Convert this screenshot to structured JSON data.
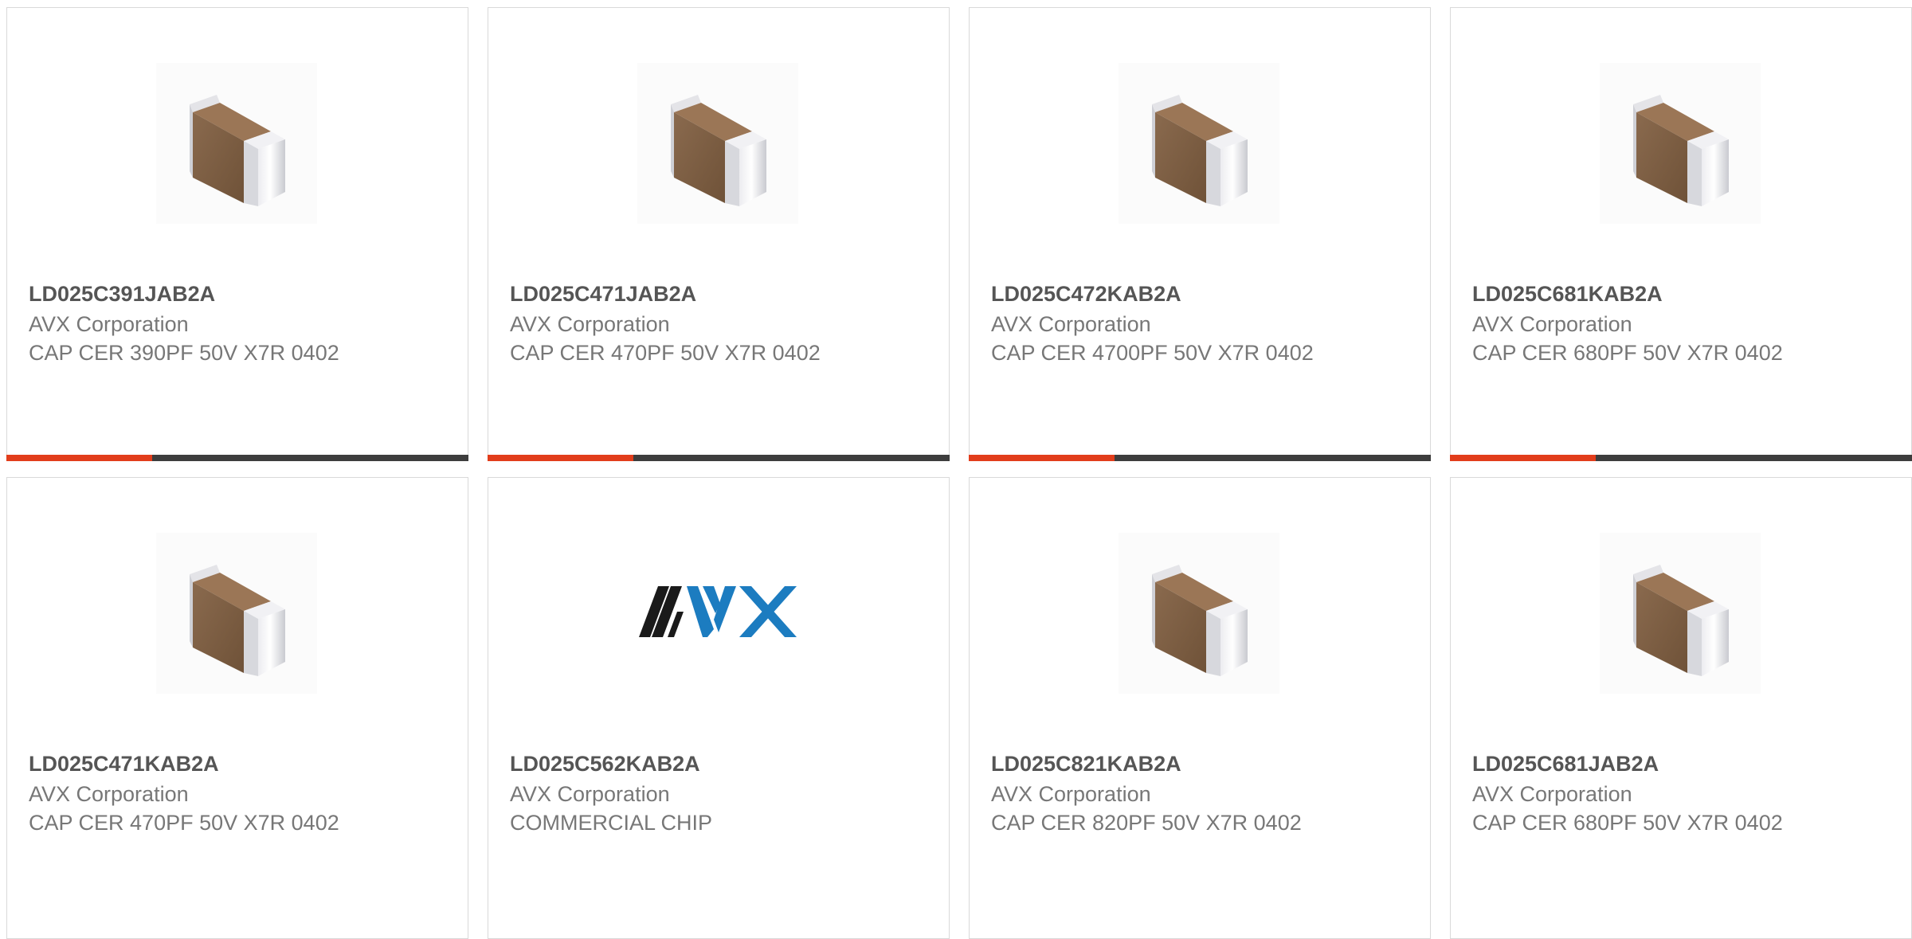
{
  "cards": [
    {
      "part_number": "LD025C391JAB2A",
      "manufacturer": "AVX Corporation",
      "description": "CAP CER 390PF 50V X7R 0402",
      "image": "capacitor-chip"
    },
    {
      "part_number": "LD025C471JAB2A",
      "manufacturer": "AVX Corporation",
      "description": "CAP CER 470PF 50V X7R 0402",
      "image": "capacitor-chip"
    },
    {
      "part_number": "LD025C472KAB2A",
      "manufacturer": "AVX Corporation",
      "description": "CAP CER 4700PF 50V X7R 0402",
      "image": "capacitor-chip"
    },
    {
      "part_number": "LD025C681KAB2A",
      "manufacturer": "AVX Corporation",
      "description": "CAP CER 680PF 50V X7R 0402",
      "image": "capacitor-chip"
    },
    {
      "part_number": "LD025C471KAB2A",
      "manufacturer": "AVX Corporation",
      "description": "CAP CER 470PF 50V X7R 0402",
      "image": "capacitor-chip"
    },
    {
      "part_number": "LD025C562KAB2A",
      "manufacturer": "AVX Corporation",
      "description": "COMMERCIAL CHIP",
      "image": "avx-logo"
    },
    {
      "part_number": "LD025C821KAB2A",
      "manufacturer": "AVX Corporation",
      "description": "CAP CER 820PF 50V X7R 0402",
      "image": "capacitor-chip"
    },
    {
      "part_number": "LD025C681JAB2A",
      "manufacturer": "AVX Corporation",
      "description": "CAP CER 680PF 50V X7R 0402",
      "image": "capacitor-chip"
    }
  ],
  "logo_text": "AVX",
  "colors": {
    "accent_bar": "#e23d1b",
    "bar_track": "#3d3d3d",
    "avx_dark": "#1a1a1a",
    "avx_blue": "#1c7cc0"
  }
}
